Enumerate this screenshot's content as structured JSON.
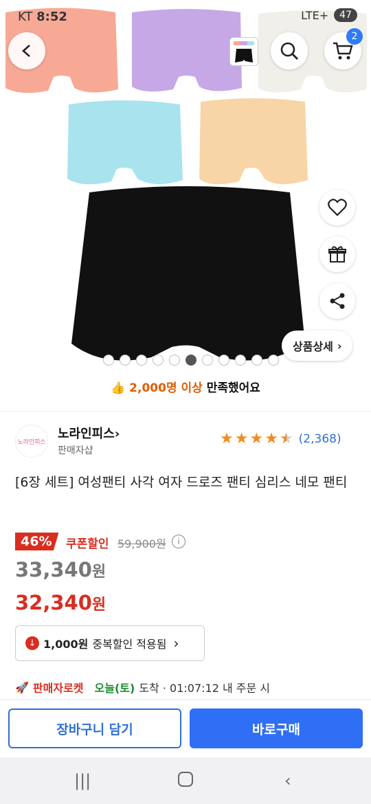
{
  "status_bar": {
    "carrier": "KT",
    "time": "8:52",
    "network": "LTE+",
    "battery": "47"
  },
  "header": {
    "cart_count": "2"
  },
  "gallery": {
    "detail_button_label": "상품상세",
    "page_count": 11,
    "current_page": 6
  },
  "satisfaction": {
    "count_text": "2,000명 이상",
    "suffix_text": "만족했어요"
  },
  "seller": {
    "name": "노라인피스",
    "type": "판매자샵",
    "logo_text": "노라인피스"
  },
  "rating": {
    "stars": 4.5,
    "review_count": "(2,368)"
  },
  "product": {
    "title": "[6장 세트] 여성팬티 사각 여자 드로즈 팬티 심리스 네모 팬티"
  },
  "pricing": {
    "discount_rate": "46%",
    "coupon_label": "쿠폰할인",
    "original_price": "59,900원",
    "price_before_coupon": "33,340",
    "final_price": "32,340",
    "currency": "원",
    "duplicate_discount_amount": "1,000원",
    "duplicate_discount_text": "중복할인 적용됨"
  },
  "delivery": {
    "badge": "판매자로켓",
    "arrival_day": "오늘(토)",
    "arrival_text": "도착 · 01:07:12 내 주문 시"
  },
  "actions": {
    "add_to_cart": "장바구니 담기",
    "buy_now": "바로구매"
  },
  "colors": {
    "accent_blue": "#2f6ff5",
    "price_red": "#d92d20",
    "rating_orange": "#f28b21",
    "delivery_green": "#1a8c2e"
  }
}
